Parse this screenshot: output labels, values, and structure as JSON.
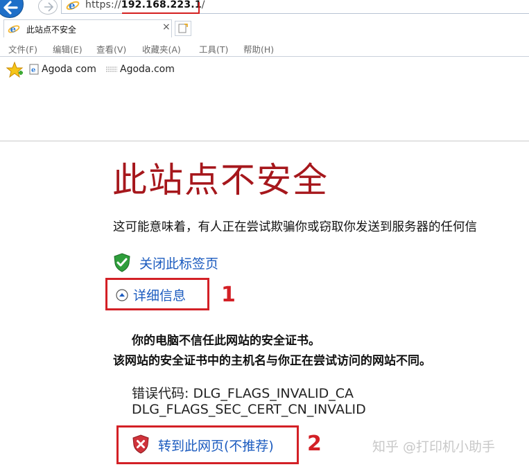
{
  "browser": {
    "url_scheme": "https://",
    "url_host": "192.168.223.1",
    "url_path": "/",
    "tab_title": "此站点不安全",
    "tab_close": "×",
    "menu": [
      "文件(F)",
      "编辑(E)",
      "查看(V)",
      "收藏夹(A)",
      "工具(T)",
      "帮助(H)"
    ],
    "favorites": [
      {
        "label": "Agoda com",
        "icon": "ie-page-icon"
      },
      {
        "label": "Agoda.com",
        "icon": "web-slice-icon"
      }
    ],
    "colors": {
      "back_button": "#1e6fc8",
      "annotation_red": "#d41e1e"
    }
  },
  "page": {
    "title": "此站点不安全",
    "description": "这可能意味着，有人正在尝试欺骗你或窃取你发送到服务器的任何信",
    "close_tab_label": "关闭此标签页",
    "details_label": "详细信息",
    "detail_line1": "你的电脑不信任此网站的安全证书。",
    "detail_line2": "该网站的安全证书中的主机名与你正在尝试访问的网站不同。",
    "error_code_line1": "错误代码: DLG_FLAGS_INVALID_CA",
    "error_code_line2": "DLG_FLAGS_SEC_CERT_CN_INVALID",
    "goto_label": "转到此网页(不推荐)",
    "colors": {
      "title": "#a6171c",
      "link": "#1b5bbf"
    }
  },
  "annotations": {
    "step1": "1",
    "step2": "2"
  },
  "watermark": "知乎 @打印机小助手"
}
